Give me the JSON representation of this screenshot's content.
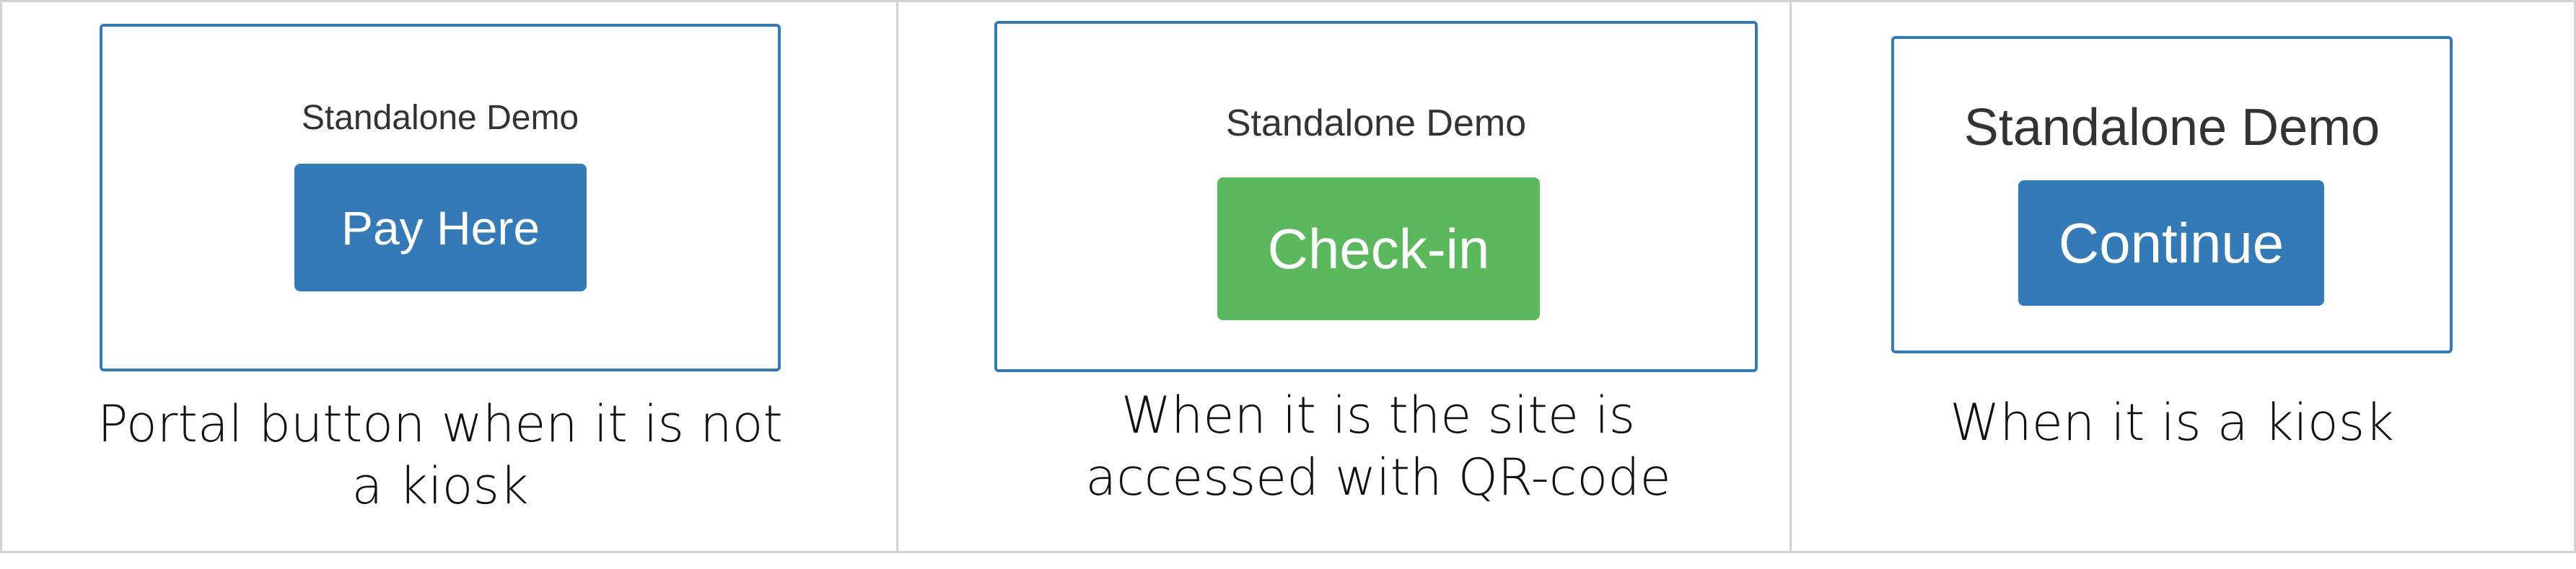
{
  "panels": [
    {
      "card_title": "Standalone Demo",
      "button_label": "Pay Here",
      "button_color": "#337ab7",
      "caption_lines": [
        "Portal button when it is not",
        "a kiosk"
      ]
    },
    {
      "card_title": "Standalone Demo",
      "button_label": "Check-in",
      "button_color": "#5cb85c",
      "caption_lines": [
        "When it is the site is",
        "accessed with QR-code"
      ]
    },
    {
      "card_title": "Standalone Demo",
      "button_label": "Continue",
      "button_color": "#337ab7",
      "caption_lines": [
        "When it is a kiosk"
      ]
    }
  ],
  "colors": {
    "border_blue": "#337ab7",
    "success_green": "#5cb85c",
    "grid_gray": "#d3d3d3"
  }
}
